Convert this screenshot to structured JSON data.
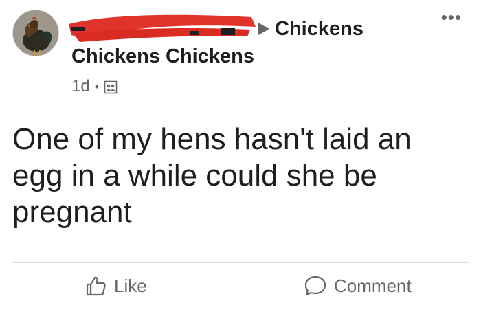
{
  "post": {
    "author_redacted": true,
    "group_name": "Chickens",
    "group_sub": "Chickens Chickens",
    "time": "1d",
    "separator": "•",
    "audience_icon": "group-icon",
    "more_icon": "•••",
    "text": "One of my hens hasn't laid an egg in a while could she be pregnant"
  },
  "actions": {
    "like_label": "Like",
    "comment_label": "Comment"
  },
  "colors": {
    "text": "#1c1e21",
    "secondary": "#65676b",
    "redaction": "#e0332a",
    "divider": "#dadde1"
  }
}
